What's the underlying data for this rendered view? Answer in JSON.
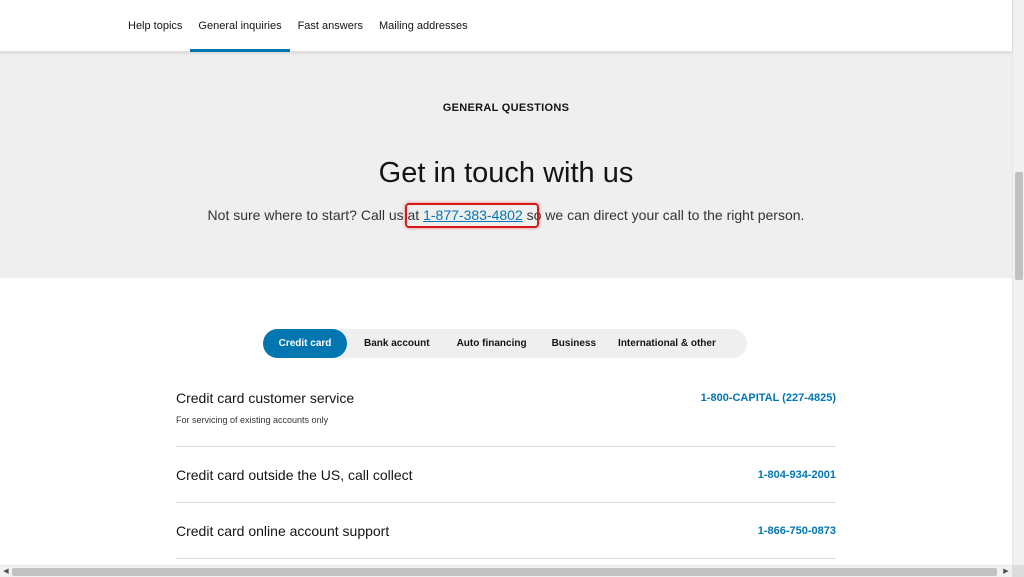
{
  "nav": {
    "tabs": [
      {
        "label": "Help topics"
      },
      {
        "label": "General inquiries"
      },
      {
        "label": "Fast answers"
      },
      {
        "label": "Mailing addresses"
      }
    ],
    "active_index": 1
  },
  "hero": {
    "eyebrow": "GENERAL QUESTIONS",
    "headline": "Get in touch with us",
    "sub_before": "Not sure where to start? Call us at ",
    "phone": "1-877-383-4802",
    "sub_after": " so we can direct your call to the right person."
  },
  "segments": [
    {
      "label": "Credit card"
    },
    {
      "label": "Bank account"
    },
    {
      "label": "Auto financing"
    },
    {
      "label": "Business"
    },
    {
      "label": "International & other"
    }
  ],
  "contacts": [
    {
      "title": "Credit card customer service",
      "note": "For servicing of existing accounts only",
      "phone": "1-800-CAPITAL (227-4825)"
    },
    {
      "title": "Credit card outside the US, call collect",
      "phone": "1-804-934-2001"
    },
    {
      "title": "Credit card online account support",
      "phone": "1-866-750-0873"
    }
  ],
  "colors": {
    "accent": "#0276b1",
    "hero_bg": "#f0efef",
    "highlight": "#d6191b"
  },
  "icons": {
    "scroll_left": "left-arrow-icon",
    "scroll_right": "right-arrow-icon"
  }
}
